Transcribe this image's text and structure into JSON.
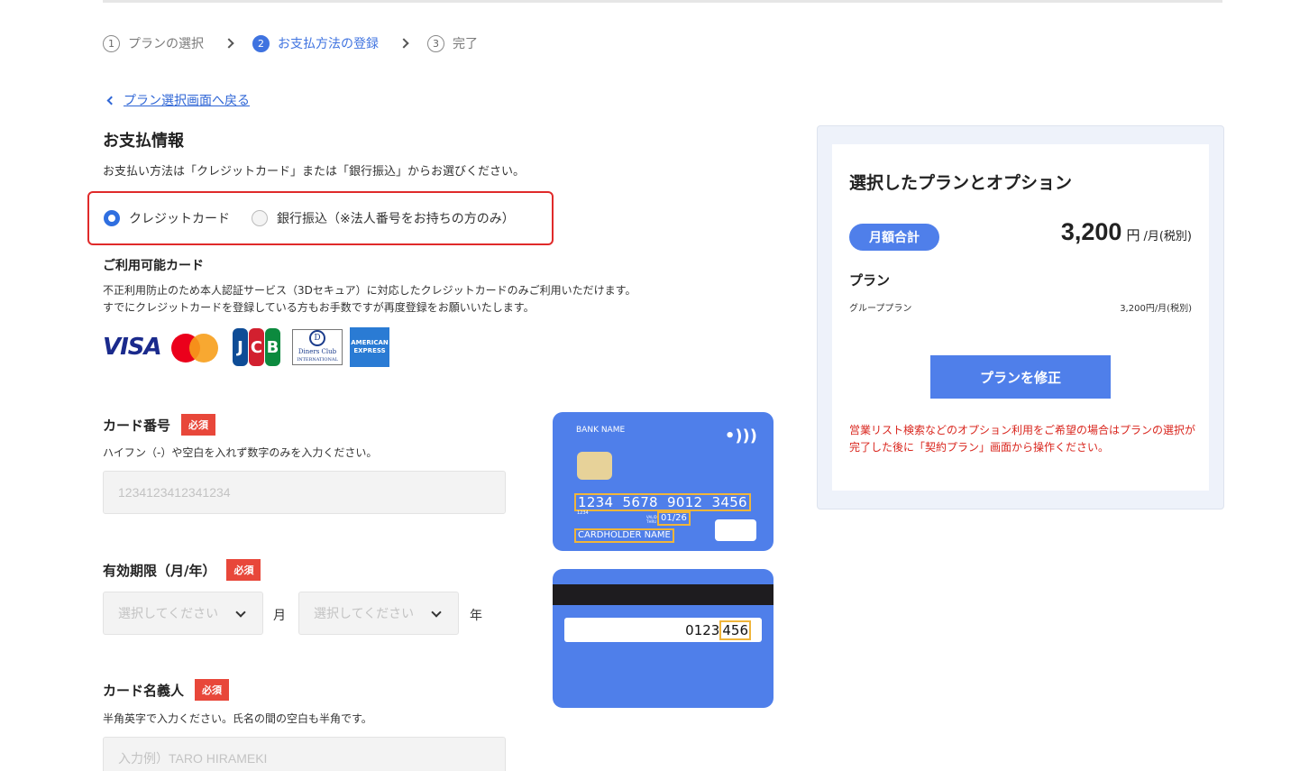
{
  "stepper": [
    {
      "num": "1",
      "label": "プランの選択"
    },
    {
      "num": "2",
      "label": "お支払方法の登録"
    },
    {
      "num": "3",
      "label": "完了"
    }
  ],
  "back_link": "プラン選択画面へ戻る",
  "payment": {
    "title": "お支払情報",
    "description": "お支払い方法は「クレジットカード」または「銀行振込」からお選びください。",
    "options": [
      {
        "label": "クレジットカード",
        "selected": true
      },
      {
        "label": "銀行振込（※法人番号をお持ちの方のみ）",
        "selected": false
      }
    ]
  },
  "cards": {
    "title": "ご利用可能カード",
    "line1": "不正利用防止のため本人認証サービス（3Dセキュア）に対応したクレジットカードのみご利用いただけます。",
    "line2": "すでにクレジットカードを登録している方もお手数ですが再度登録をお願いいたします。",
    "brands": {
      "visa": "VISA",
      "jcb": [
        "J",
        "C",
        "B"
      ],
      "diners_mark": "D",
      "diners_name": "Diners Club",
      "diners_sub": "INTERNATIONAL",
      "amex_1": "AMERICAN",
      "amex_2": "EXPRESS"
    }
  },
  "form": {
    "required_badge": "必須",
    "card_number": {
      "label": "カード番号",
      "help": "ハイフン（-）や空白を入れず数字のみを入力ください。",
      "placeholder": "1234123412341234"
    },
    "expiry": {
      "label": "有効期限（月/年）",
      "month_placeholder": "選択してください",
      "month_unit": "月",
      "year_placeholder": "選択してください",
      "year_unit": "年"
    },
    "holder": {
      "label": "カード名義人",
      "help": "半角英字で入力ください。氏名の間の空白も半角です。",
      "placeholder": "入力例）TARO HIRAMEKI"
    }
  },
  "card_illustration": {
    "bank_name": "BANK NAME",
    "number": "1234  5678  9012  3456",
    "number_small": "1234",
    "valid_thru_1": "VALID",
    "valid_thru_2": "THRU",
    "expiry": "01/26",
    "holder": "CARDHOLDER NAME",
    "cvv_prefix": "0123",
    "cvv": "456"
  },
  "summary": {
    "title": "選択したプランとオプション",
    "monthly_total_label": "月額合計",
    "amount": "3,200",
    "currency": "円",
    "per": "/月(税別)",
    "plan_label": "プラン",
    "plan_name": "グループプラン",
    "plan_price": "3,200円/月(税別)",
    "edit_button": "プランを修正",
    "notice": "営業リスト検索などのオプション利用をご希望の場合はプランの選択が完了した後に「契約プラン」画面から操作ください。"
  },
  "colors": {
    "accent": "#4f7fea",
    "link": "#2f66d6",
    "required": "#e8473a",
    "highlight_border": "#e02a2a",
    "notice": "#d9251d"
  }
}
